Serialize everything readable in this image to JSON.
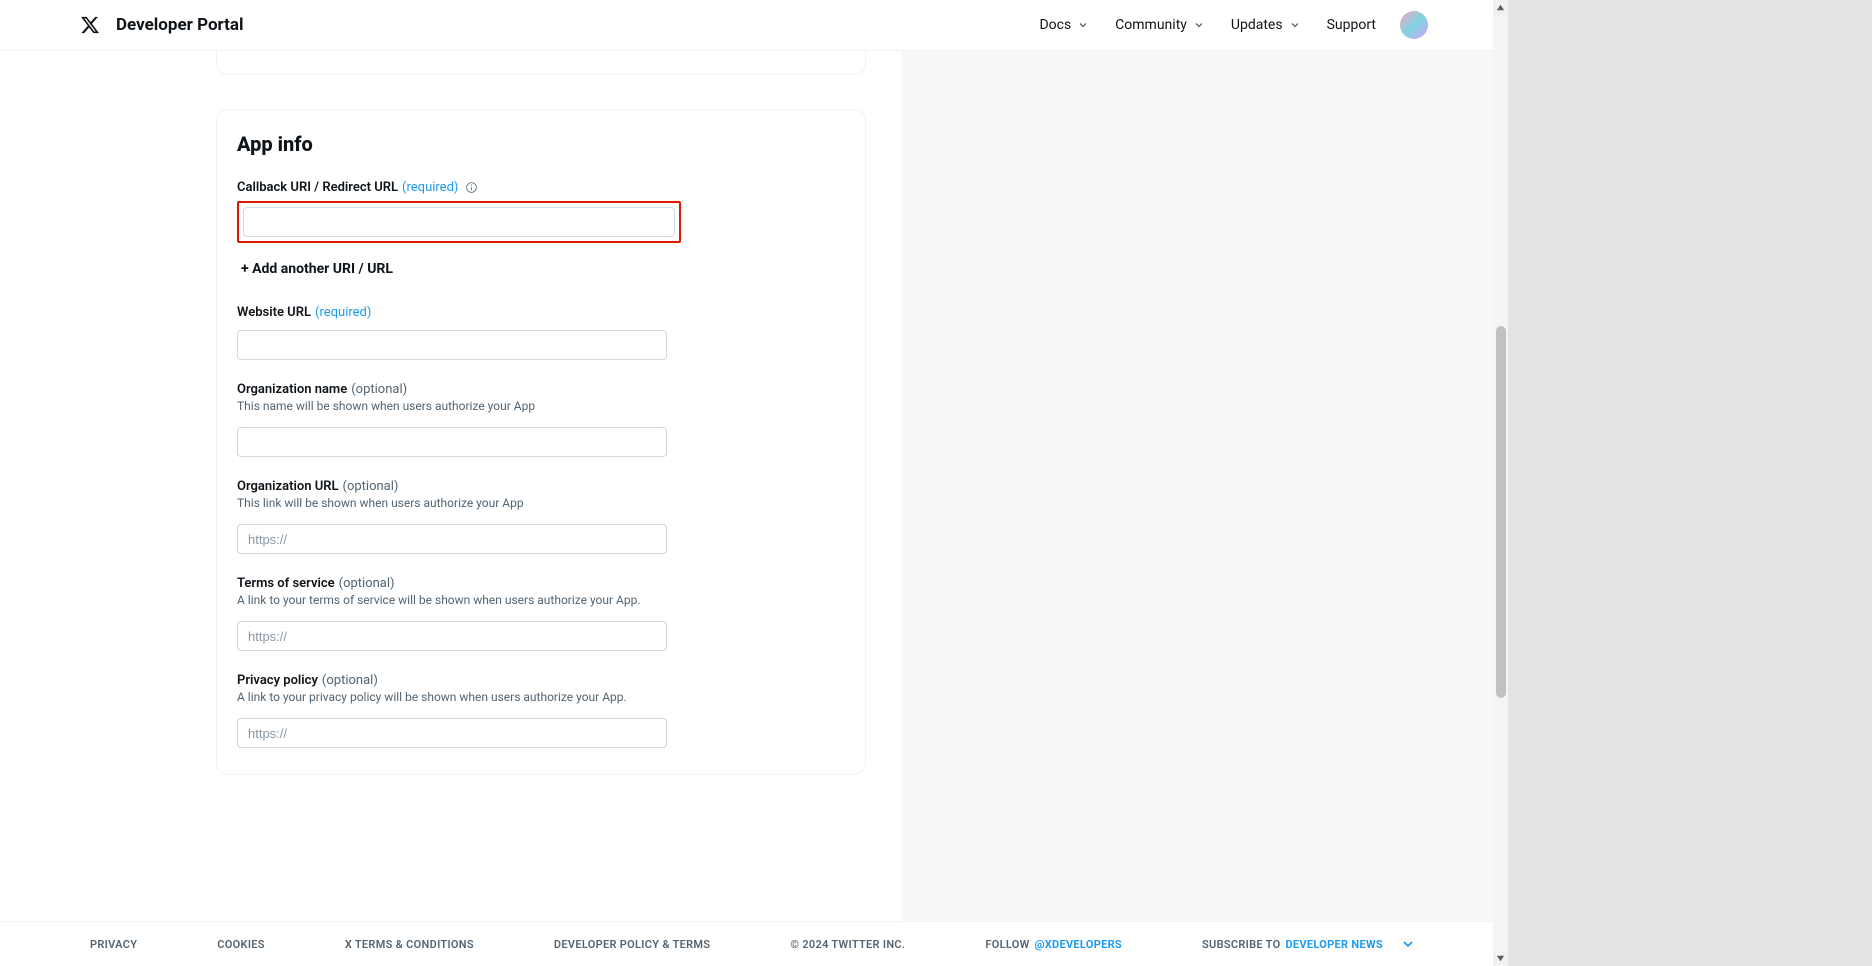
{
  "header": {
    "title": "Developer Portal",
    "nav": {
      "docs": "Docs",
      "community": "Community",
      "updates": "Updates",
      "support": "Support"
    }
  },
  "card": {
    "title": "App info",
    "callback": {
      "label": "Callback URI / Redirect URL",
      "required": "(required)",
      "value": ""
    },
    "addAnother": "+ Add another URI / URL",
    "website": {
      "label": "Website URL",
      "required": "(required)",
      "value": ""
    },
    "orgName": {
      "label": "Organization name",
      "optional": "(optional)",
      "hint": "This name will be shown when users authorize your App"
    },
    "orgUrl": {
      "label": "Organization URL",
      "optional": "(optional)",
      "hint": "This link will be shown when users authorize your App",
      "placeholder": "https://"
    },
    "tos": {
      "label": "Terms of service",
      "optional": "(optional)",
      "hint": "A link to your terms of service will be shown when users authorize your App.",
      "placeholder": "https://"
    },
    "privacy": {
      "label": "Privacy policy",
      "optional": "(optional)",
      "hint": "A link to your privacy policy will be shown when users authorize your App.",
      "placeholder": "https://"
    }
  },
  "footer": {
    "privacy": "PRIVACY",
    "cookies": "COOKIES",
    "xterms": "X TERMS & CONDITIONS",
    "devpolicy": "DEVELOPER POLICY & TERMS",
    "copyright": "© 2024 TWITTER INC.",
    "follow": "FOLLOW",
    "followHandle": "@XDEVELOPERS",
    "subscribe": "SUBSCRIBE TO",
    "devnews": "DEVELOPER NEWS"
  }
}
